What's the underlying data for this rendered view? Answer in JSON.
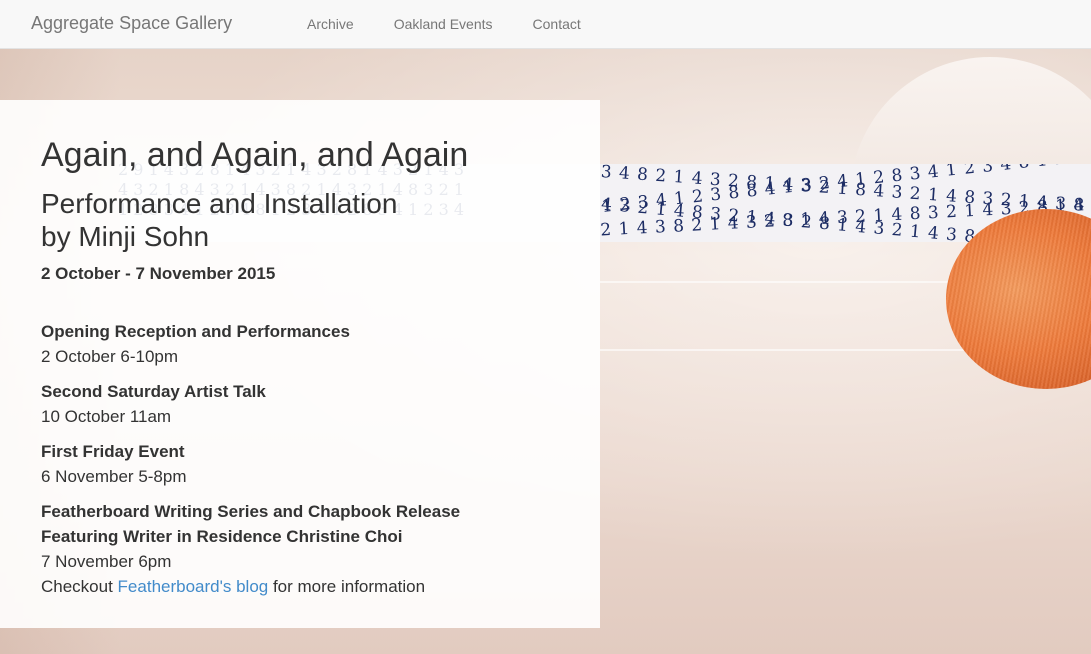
{
  "navbar": {
    "brand": "Aggregate Space Gallery",
    "links": [
      "Archive",
      "Oakland Events",
      "Contact"
    ]
  },
  "exhibition": {
    "title": "Again, and Again, and Again",
    "subtitle_line1": "Performance and Installation",
    "subtitle_line2": "by Minji Sohn",
    "dates": "2 October - 7 November 2015"
  },
  "events": [
    {
      "title": "Opening Reception and Performances",
      "time": "2 October 6-10pm"
    },
    {
      "title": "Second Saturday Artist Talk",
      "time": "10 October 11am"
    },
    {
      "title": "First Friday Event",
      "time": "6 November 5-8pm"
    },
    {
      "title_line1": "Featherboard Writing Series and Chapbook Release",
      "title_line2": "Featuring Writer in Residence Christine Choi",
      "time": "7 November 6pm",
      "note_prefix": "Checkout ",
      "link_text": "Featherboard's blog",
      "note_suffix": " for more information"
    }
  ],
  "colors": {
    "navbar_bg": "#f8f8f8",
    "text": "#333333",
    "nav_text": "#777777",
    "link": "#428bca",
    "orange_object": "#ee7a3a",
    "numeral_ink": "#1c2c64"
  }
}
